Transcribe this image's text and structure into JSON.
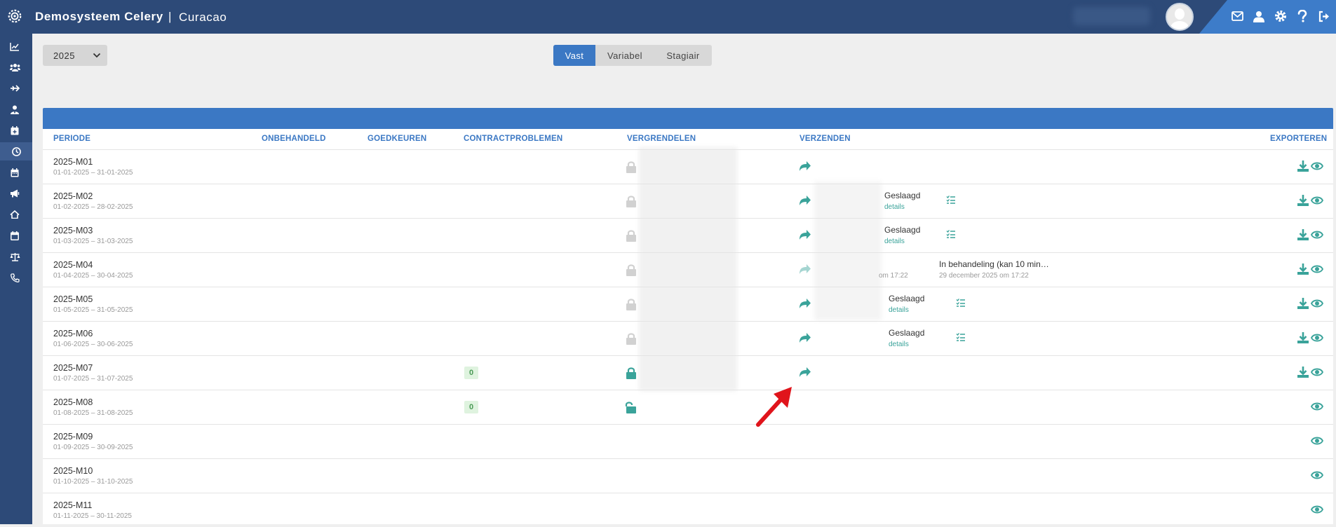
{
  "header": {
    "title": "Demosysteem Celery",
    "separator": "|",
    "subtitle": "Curacao",
    "icons": [
      "envelope-icon",
      "user-icon",
      "gear-icon",
      "help-icon",
      "logout-icon"
    ]
  },
  "sidebar": {
    "icons": [
      "chart-line-icon",
      "users-icon",
      "plane-icon",
      "user-tie-icon",
      "calendar-plus-icon",
      "clock-icon",
      "calendar-icon",
      "megaphone-icon",
      "home-icon",
      "calendar-day-icon",
      "scale-icon",
      "phone-icon"
    ],
    "active_index": 5
  },
  "filters": {
    "year": "2025",
    "tabs": [
      "Vast",
      "Variabel",
      "Stagiair"
    ],
    "active_tab": "Vast"
  },
  "table": {
    "headers": {
      "periode": "PERIODE",
      "onbehandeld": "ONBEHANDELD",
      "goedkeuren": "GOEDKEUREN",
      "contractproblemen": "CONTRACTPROBLEMEN",
      "vergrendelen": "VERGRENDELEN",
      "verzenden": "VERZENDEN",
      "exporteren": "EXPORTEREN"
    },
    "rows": [
      {
        "name": "2025-M01",
        "range": "01-01-2025 – 31-01-2025"
      },
      {
        "name": "2025-M02",
        "range": "01-02-2025 – 28-02-2025",
        "status": "Geslaagd",
        "status_link": "details"
      },
      {
        "name": "2025-M03",
        "range": "01-03-2025 – 31-03-2025",
        "status": "Geslaagd",
        "status_link": "details"
      },
      {
        "name": "2025-M04",
        "range": "01-04-2025 – 30-04-2025",
        "partial": "om 17:22",
        "status": "In behandeling (kan 10 min…",
        "status_date": "29 december 2025 om 17:22"
      },
      {
        "name": "2025-M05",
        "range": "01-05-2025 – 31-05-2025",
        "status": "Geslaagd",
        "status_link": "details"
      },
      {
        "name": "2025-M06",
        "range": "01-06-2025 – 30-06-2025",
        "status": "Geslaagd",
        "status_link": "details"
      },
      {
        "name": "2025-M07",
        "range": "01-07-2025 – 31-07-2025",
        "contract_count": "0"
      },
      {
        "name": "2025-M08",
        "range": "01-08-2025 – 31-08-2025",
        "contract_count": "0"
      },
      {
        "name": "2025-M09",
        "range": "01-09-2025 – 30-09-2025"
      },
      {
        "name": "2025-M10",
        "range": "01-10-2025 – 31-10-2025"
      },
      {
        "name": "2025-M11",
        "range": "01-11-2025 – 30-11-2025"
      }
    ]
  },
  "colors": {
    "navy": "#2d4a78",
    "accent_blue": "#3b78c4",
    "teal": "#3aa39a",
    "annotation_red": "#e0141b"
  }
}
